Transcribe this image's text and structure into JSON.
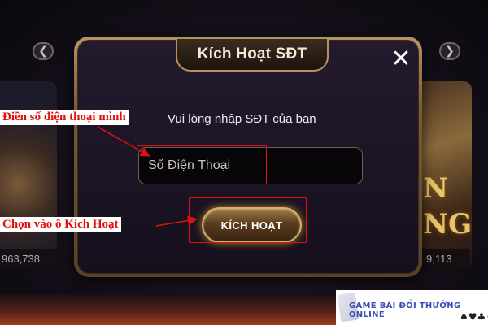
{
  "background": {
    "left_count": "963,738",
    "right_count": "9,113",
    "left_arrow": "❮",
    "right_arrow": "❯",
    "right_card_text": "N\nNG"
  },
  "modal": {
    "title": "Kích Hoạt SĐT",
    "close_label": "✕",
    "prompt": "Vui lòng nhập SĐT của bạn",
    "phone_placeholder": "Số Điện Thoại",
    "phone_value": "",
    "activate_label": "KÍCH HOẠT"
  },
  "annotations": {
    "phone_hint": "Điền số điện thoại mình",
    "activate_hint": "Chọn vào ô Kích Hoạt",
    "color": "#e01010"
  },
  "watermark": {
    "text": "GAME BÀI ĐỔI THƯỞNG ONLINE",
    "suits": "♠♥♣♦"
  },
  "colors": {
    "modal_frame": "#b89464",
    "modal_bg": "#1b1424",
    "button_glow": "#b8862e"
  }
}
